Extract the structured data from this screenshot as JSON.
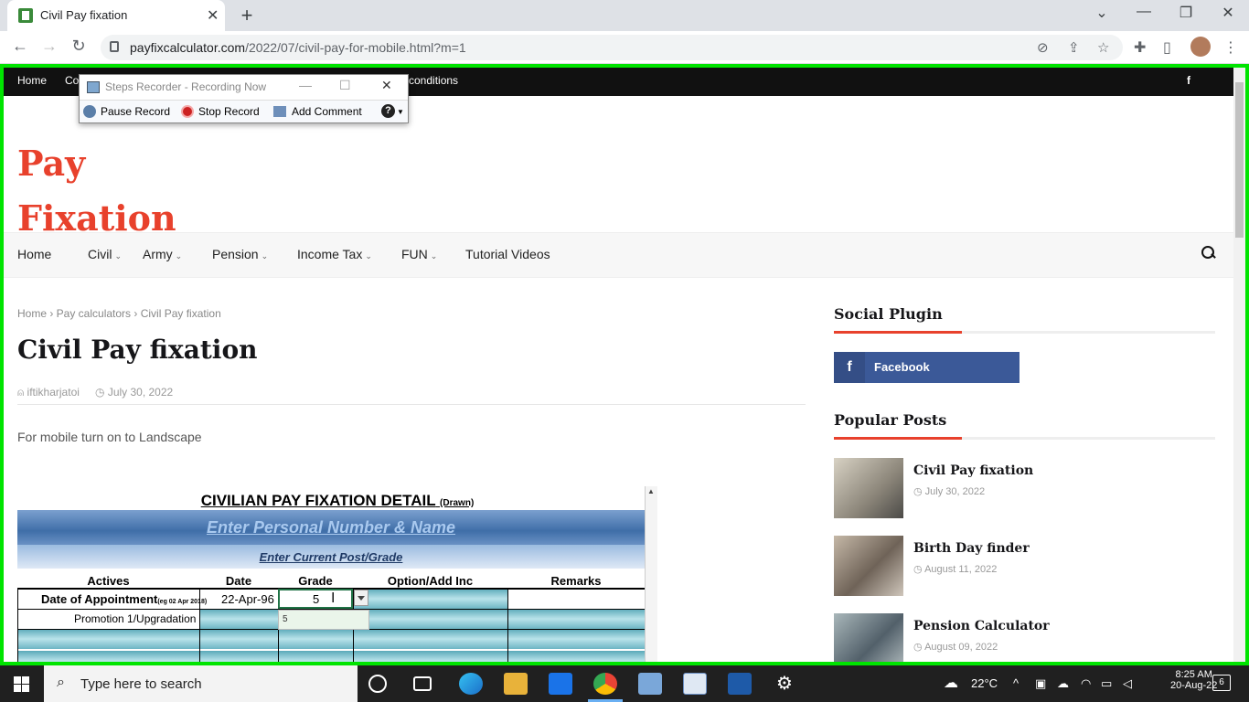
{
  "browser": {
    "tab_title": "Civil Pay fixation",
    "tab_close": "✕",
    "new_tab": "+",
    "url_host": "payfixcalculator.com",
    "url_path": "/2022/07/civil-pay-for-mobile.html?m=1",
    "win_controls": [
      "⌄",
      "—",
      "❐",
      "✕"
    ]
  },
  "site": {
    "topbar_items": [
      "Home",
      "Co",
      "conditions"
    ],
    "logo_line1": "Pay",
    "logo_line2": "Fixation",
    "nav": [
      "Home",
      "Civil",
      "Army",
      "Pension",
      "Income Tax",
      "FUN",
      "Tutorial Videos"
    ],
    "nav_dropdowns": [
      false,
      true,
      true,
      true,
      true,
      true,
      false
    ]
  },
  "post": {
    "breadcrumb": "Home › Pay calculators › Civil Pay fixation",
    "title": "Civil Pay fixation",
    "author": "iftikharjatoi",
    "date": "July 30, 2022",
    "intro": "For mobile turn on to Landscape"
  },
  "sheet": {
    "title": "CIVILIAN PAY FIXATION DETAIL",
    "title_suffix": "(Drawn)",
    "band1": "Enter Personal Number & Name",
    "band2": "Enter Current Post/Grade",
    "headers": [
      "Actives",
      "Date",
      "Grade",
      "Option/Add Inc",
      "Remarks"
    ],
    "row1_label": "Date of Appointment",
    "row1_hint": "(eg 02 Apr 2018)",
    "row1_date": "22-Apr-96",
    "row1_grade": "5",
    "row2_label": "Promotion 1/Upgradation",
    "dropdown_option": "5"
  },
  "sidebar": {
    "social_heading": "Social Plugin",
    "facebook_label": "Facebook",
    "popular_heading": "Popular Posts",
    "posts": [
      {
        "title": "Civil Pay fixation",
        "date": "July 30, 2022"
      },
      {
        "title": "Birth Day finder",
        "date": "August 11, 2022"
      },
      {
        "title": "Pension Calculator",
        "date": "August 09, 2022"
      }
    ]
  },
  "recorder": {
    "title": "Steps Recorder - Recording Now",
    "pause": "Pause Record",
    "stop": "Stop Record",
    "comment": "Add Comment",
    "help": "?"
  },
  "taskbar": {
    "search_placeholder": "Type here to search",
    "weather": "22°C",
    "time": "8:25 AM",
    "date": "20-Aug-22",
    "notifications": "6"
  },
  "colors": {
    "accent_red": "#e8412c",
    "frame_green": "#00e400",
    "facebook_blue": "#3b5998"
  }
}
